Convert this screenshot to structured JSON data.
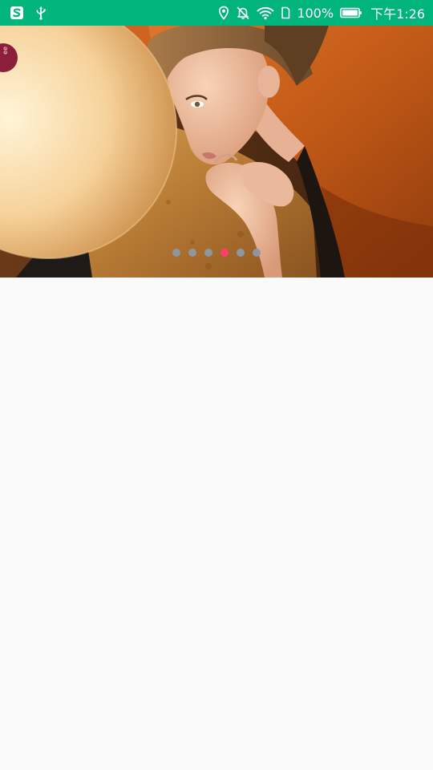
{
  "status_bar": {
    "background": "#00b47a",
    "left_icons": [
      "sogou-input-icon",
      "usb-icon"
    ],
    "right_icons": [
      "location-icon",
      "mute-icon",
      "wifi-icon",
      "sim-icon",
      "battery-icon"
    ],
    "battery_percent": "100%",
    "time": "下午1:26"
  },
  "banner": {
    "slide_count": 6,
    "active_index": 3,
    "active_dot_color": "#ff3d6e",
    "inactive_dot_color": "#8e96a0",
    "corner_badge_text": "ee"
  }
}
